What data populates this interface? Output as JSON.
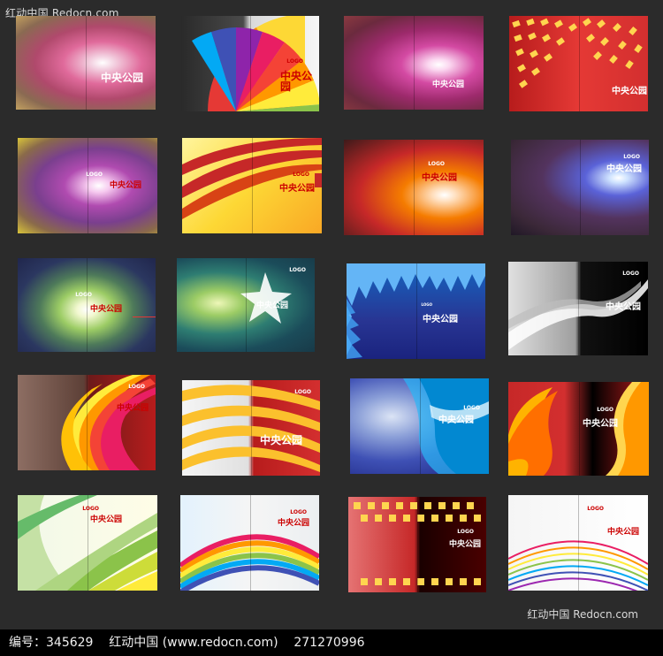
{
  "watermark": {
    "top_left": "红动中国 Redocn.com",
    "bottom_right": "红动中国  Redocn.com"
  },
  "footer": {
    "text": "编号：345629    红动中国 (www.redocn.com)    271270996"
  },
  "covers": [
    {
      "title": "中央公园",
      "logo": "",
      "fine": "",
      "theme": "pink-glow"
    },
    {
      "title": "中央公园",
      "logo": "LOGO",
      "fine": "",
      "theme": "rainbow-fan"
    },
    {
      "title": "中央公园",
      "logo": "",
      "fine": "",
      "theme": "magenta-burst"
    },
    {
      "title": "中央公园",
      "logo": "",
      "fine": "",
      "theme": "red-dots"
    },
    {
      "title": "中央公园",
      "logo": "LOGO",
      "fine": "",
      "theme": "violet-glow"
    },
    {
      "title": "中央公园",
      "logo": "LOGO",
      "fine": "",
      "theme": "yellow-stripes"
    },
    {
      "title": "中央公园",
      "logo": "LOGO",
      "fine": "",
      "theme": "orange-burst"
    },
    {
      "title": "中央公园",
      "logo": "LOGO",
      "fine": "",
      "theme": "purple-light"
    },
    {
      "title": "中央公园",
      "logo": "LOGO",
      "fine": "",
      "theme": "green-ring"
    },
    {
      "title": "中央公园",
      "logo": "LOGO",
      "fine": "",
      "theme": "teal-star"
    },
    {
      "title": "中央公园",
      "logo": "LOGO",
      "fine": "",
      "theme": "blue-spikes"
    },
    {
      "title": "中央公园",
      "logo": "LOGO",
      "fine": "",
      "theme": "black-wave"
    },
    {
      "title": "中央公园",
      "logo": "LOGO",
      "fine": "",
      "theme": "red-rainbow-wave"
    },
    {
      "title": "中央公园",
      "logo": "LOGO",
      "fine": "",
      "theme": "red-yellow-stripes"
    },
    {
      "title": "中央公园",
      "logo": "LOGO",
      "fine": "",
      "theme": "blue-curtain"
    },
    {
      "title": "中央公园",
      "logo": "LOGO",
      "fine": "",
      "theme": "red-flame"
    },
    {
      "title": "中央公园",
      "logo": "LOGO",
      "fine": "",
      "theme": "green-bands"
    },
    {
      "title": "中央公园",
      "logo": "LOGO",
      "fine": "",
      "theme": "rainbow-arc"
    },
    {
      "title": "中央公园",
      "logo": "LOGO",
      "fine": "",
      "theme": "yellow-squares"
    },
    {
      "title": "中央公园",
      "logo": "LOGO",
      "fine": "",
      "theme": "white-rainbow-lines"
    }
  ]
}
